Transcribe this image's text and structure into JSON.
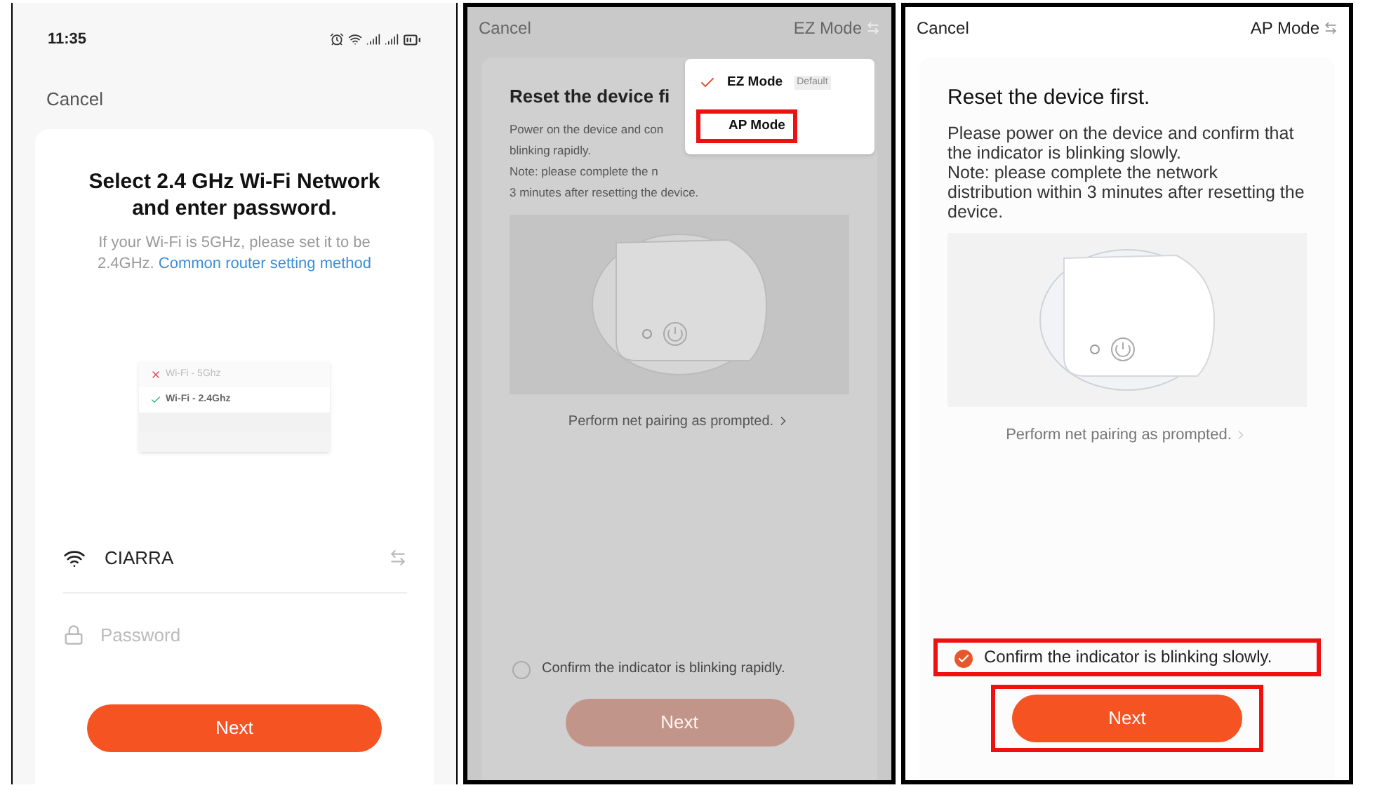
{
  "screens": [
    {
      "kind": "wifi",
      "dimmed": false,
      "status_bar": {
        "time": "11:35"
      },
      "cancel": "Cancel",
      "title": "Select 2.4 GHz Wi-Fi Network and enter password.",
      "hint": "If your Wi-Fi is 5GHz, please set it to be 2.4GHz.",
      "link": "Common router setting method",
      "networks": [
        {
          "name": "Wi-Fi - 5Ghz",
          "ok": false
        },
        {
          "name": "Wi-Fi - 2.4Ghz",
          "ok": true
        }
      ],
      "ssid": "CIARRA",
      "password": {
        "placeholder": "Password"
      },
      "next": {
        "label": "Next",
        "disabled": false,
        "highlighted": false
      }
    },
    {
      "kind": "reset",
      "dimmed": true,
      "cancel": "Cancel",
      "mode": "EZ Mode",
      "menu_open": true,
      "title": "Reset the device fi",
      "body": [
        "Power on the device and con",
        "blinking rapidly.",
        "Note: please complete the n",
        "3 minutes after resetting the device."
      ],
      "menu": [
        {
          "label": "EZ Mode",
          "badge": "Default",
          "selected": true,
          "highlighted": false
        },
        {
          "label": "AP Mode",
          "selected": false,
          "highlighted": true
        }
      ],
      "prompt": "Perform net pairing as prompted.",
      "confirm": {
        "label": "Confirm the indicator is blinking rapidly.",
        "checked": false,
        "highlighted": false
      },
      "next": {
        "label": "Next",
        "disabled": true,
        "highlighted": false
      }
    },
    {
      "kind": "reset",
      "dimmed": false,
      "cancel": "Cancel",
      "mode": "AP Mode",
      "menu_open": false,
      "title": "Reset the device first.",
      "body": [
        "Please power on the device and confirm that the indicator is blinking slowly.",
        "Note: please complete the network distribution within 3 minutes after resetting the device."
      ],
      "prompt": "Perform net pairing as prompted.",
      "confirm": {
        "label": "Confirm the indicator is blinking slowly.",
        "checked": true,
        "highlighted": true
      },
      "next": {
        "label": "Next",
        "disabled": false,
        "highlighted": true
      }
    }
  ]
}
